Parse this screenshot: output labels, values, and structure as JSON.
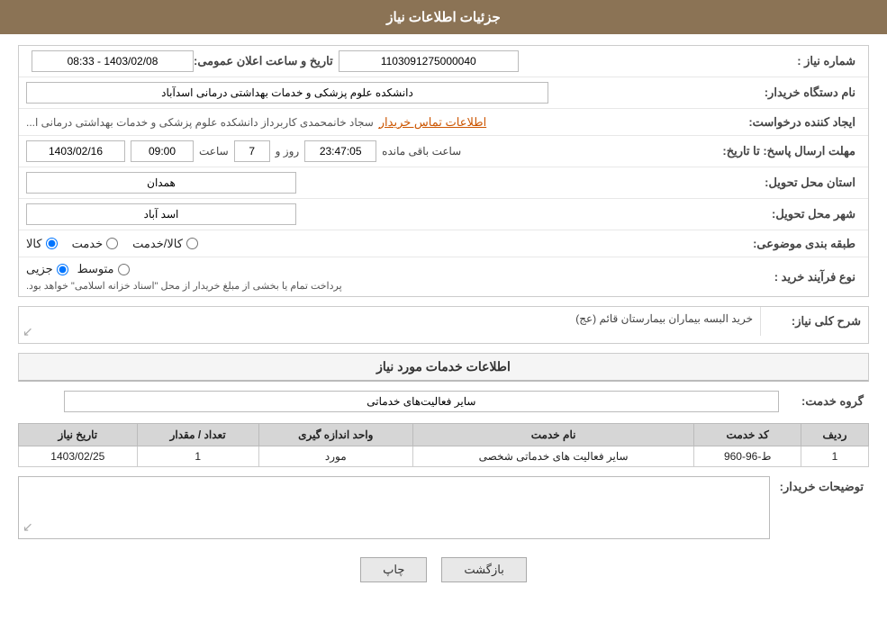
{
  "page": {
    "title": "جزئیات اطلاعات نیاز",
    "sections": {
      "main_info": {
        "label": "جزئیات اطلاعات نیاز"
      },
      "services_info": {
        "label": "اطلاعات خدمات مورد نیاز"
      }
    }
  },
  "fields": {
    "need_number_label": "شماره نیاز :",
    "need_number_value": "1103091275000040",
    "announcement_datetime_label": "تاریخ و ساعت اعلان عمومی:",
    "announcement_datetime_value": "1403/02/08 - 08:33",
    "buyer_org_label": "نام دستگاه خریدار:",
    "buyer_org_value": "دانشکده علوم پزشکی و خدمات بهداشتی درمانی اسدآباد",
    "creator_label": "ایجاد کننده درخواست:",
    "creator_name": "سجاد خانمحمدی کاربرداز دانشکده علوم پزشکی و خدمات بهداشتی درمانی ا...",
    "creator_link": "اطلاعات تماس خریدار",
    "response_deadline_label": "مهلت ارسال پاسخ: تا تاریخ:",
    "response_date": "1403/02/16",
    "response_time_label": "ساعت",
    "response_time": "09:00",
    "response_days_label": "روز و",
    "response_days": "7",
    "response_remaining_label": "ساعت باقی مانده",
    "response_remaining": "23:47:05",
    "province_label": "استان محل تحویل:",
    "province_value": "همدان",
    "city_label": "شهر محل تحویل:",
    "city_value": "اسد آباد",
    "category_label": "طبقه بندی موضوعی:",
    "category_options": [
      "کالا",
      "خدمت",
      "کالا/خدمت"
    ],
    "category_selected": "کالا",
    "purchase_type_label": "نوع فرآیند خرید :",
    "purchase_type_options": [
      "جزیی",
      "متوسط"
    ],
    "purchase_type_notice": "پرداخت تمام یا بخشی از مبلغ خریدار از محل \"اسناد خزانه اسلامی\" خواهد بود.",
    "description_label": "شرح کلی نیاز:",
    "description_value": "خرید البسه بیماران بیمارستان قائم (عج)",
    "service_group_label": "گروه خدمت:",
    "service_group_value": "سایر فعالیت‌های خدماتی"
  },
  "table": {
    "headers": [
      "ردیف",
      "کد خدمت",
      "نام خدمت",
      "واحد اندازه گیری",
      "تعداد / مقدار",
      "تاریخ نیاز"
    ],
    "rows": [
      {
        "row_num": "1",
        "code": "ط-96-960",
        "name": "سایر فعالیت های خدماتی شخصی",
        "unit": "مورد",
        "qty": "1",
        "date": "1403/02/25"
      }
    ]
  },
  "buyer_desc": {
    "label": "توضیحات خریدار:",
    "value": ""
  },
  "buttons": {
    "print_label": "چاپ",
    "back_label": "بازگشت"
  }
}
